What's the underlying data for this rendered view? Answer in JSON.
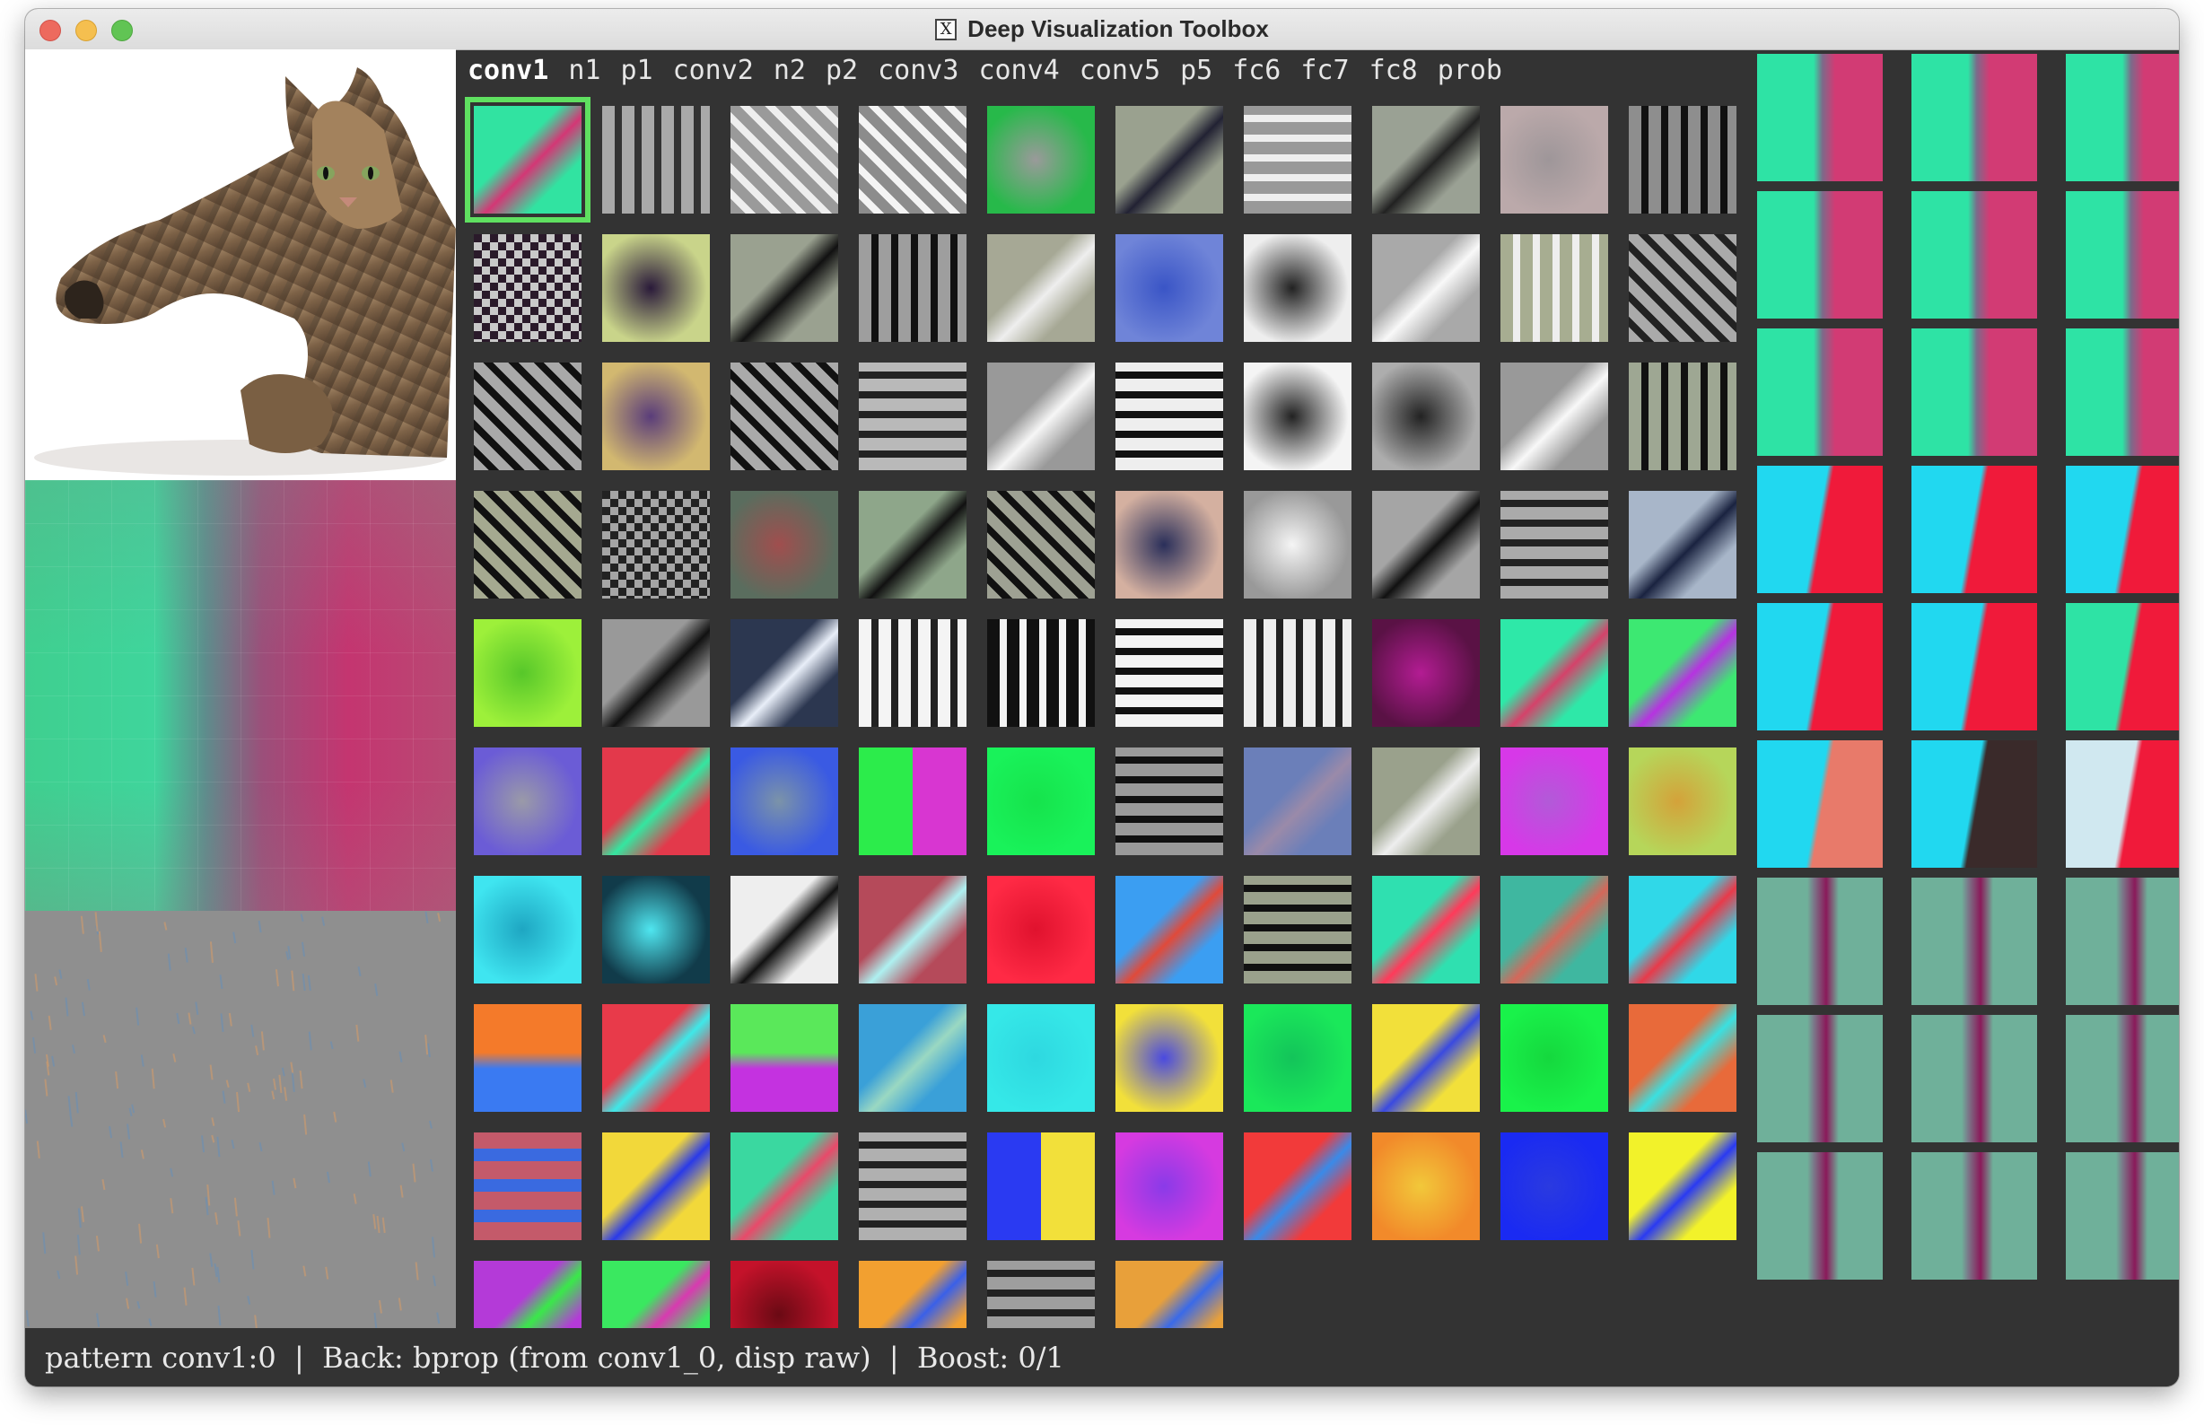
{
  "window": {
    "title": "Deep Visualization Toolbox"
  },
  "layers": [
    "conv1",
    "n1",
    "p1",
    "conv2",
    "n2",
    "p2",
    "conv3",
    "conv4",
    "conv5",
    "p5",
    "fc6",
    "fc7",
    "fc8",
    "prob"
  ],
  "active_layer": "conv1",
  "status": {
    "text": "pattern conv1:0  |  Back: bprop (from conv1_0, disp raw)  |  Boost: 0/1"
  },
  "panels": {
    "input_image": "cat-photo",
    "selected_unit_zoom": "unit-0-zoomed",
    "backprop_view": "bprop-gradient-view"
  },
  "filters": [
    [
      "#31e3a1",
      "#d33775",
      "diag"
    ],
    [
      "#a9a9a9",
      "#333",
      "vbars"
    ],
    [
      "#9a9a9a",
      "#eee",
      "diagbars"
    ],
    [
      "#8c8c8c",
      "#f4f4f4",
      "diagbars"
    ],
    [
      "#27b94a",
      "#9a9a9a",
      "blob"
    ],
    [
      "#9aa18f",
      "#223",
      "diag"
    ],
    [
      "#999",
      "#eee",
      "hbars"
    ],
    [
      "#9aa194",
      "#222",
      "diag"
    ],
    [
      "#bba9aa",
      "#9e9699",
      "blob"
    ],
    [
      "#8e8e8e",
      "#111",
      "vbars"
    ],
    [
      "#c9c9c9",
      "#2a1a2a",
      "checker"
    ],
    [
      "#c9d48a",
      "#2a1a3a",
      "blob"
    ],
    [
      "#9aa190",
      "#111",
      "diag"
    ],
    [
      "#9e9e9e",
      "#111",
      "vbars"
    ],
    [
      "#a6a895",
      "#eee",
      "diag"
    ],
    [
      "#6f84d8",
      "#3a55c6",
      "blob"
    ],
    [
      "#eeeeee",
      "#222",
      "blob"
    ],
    [
      "#a9a9a9",
      "#f8f8f8",
      "diag"
    ],
    [
      "#a7ad91",
      "#eee",
      "vbars"
    ],
    [
      "#aaaaaa",
      "#222",
      "diagbars"
    ],
    [
      "#a9a9a9",
      "#111",
      "diagbars"
    ],
    [
      "#d2b870",
      "#5a3d7a",
      "blob"
    ],
    [
      "#aaaaaa",
      "#111",
      "diagbars"
    ],
    [
      "#b9b9b9",
      "#222",
      "hbars"
    ],
    [
      "#999",
      "#f6f6f6",
      "diag"
    ],
    [
      "#eeeeee",
      "#111",
      "hbars"
    ],
    [
      "#f4f4f4",
      "#222",
      "blob"
    ],
    [
      "#adadad",
      "#222",
      "blob"
    ],
    [
      "#999",
      "#f8f8f8",
      "diag"
    ],
    [
      "#9ea793",
      "#111",
      "vbars"
    ],
    [
      "#a5a990",
      "#111",
      "diagbars"
    ],
    [
      "#a5a5a5",
      "#222",
      "checker"
    ],
    [
      "#5a6d5e",
      "#a04e4e",
      "blob"
    ],
    [
      "#8ea68a",
      "#111",
      "diag"
    ],
    [
      "#9ea193",
      "#111",
      "diagbars"
    ],
    [
      "#d4b0a0",
      "#2a2f5a",
      "blob"
    ],
    [
      "#999",
      "#f5f5f5",
      "blob"
    ],
    [
      "#a5a5a5",
      "#111",
      "diag"
    ],
    [
      "#aaa",
      "#222",
      "hbars"
    ],
    [
      "#a8b6c9",
      "#1a2340",
      "diag"
    ],
    [
      "#9df03a",
      "#57c72a",
      "blob"
    ],
    [
      "#999",
      "#111",
      "diag"
    ],
    [
      "#2c3750",
      "#e8eef8",
      "diag"
    ],
    [
      "#f4f4f4",
      "#222",
      "vbars"
    ],
    [
      "#111",
      "#f4f4f4",
      "vbars"
    ],
    [
      "#f4f4f4",
      "#111",
      "hbars"
    ],
    [
      "#eee",
      "#222",
      "vbars"
    ],
    [
      "#5a1245",
      "#b31c93",
      "blob"
    ],
    [
      "#2ee8a8",
      "#d4426a",
      "diag"
    ],
    [
      "#3de872",
      "#b633e0",
      "diag"
    ],
    [
      "#6b5cd6",
      "#9a9aa8",
      "blob"
    ],
    [
      "#e3394b",
      "#34e6a0",
      "diag"
    ],
    [
      "#3a5ae3",
      "#7b93a9",
      "blob"
    ],
    [
      "#2cec4b",
      "#d836d1",
      "vsplit"
    ],
    [
      "#19f25a",
      "#16e34c",
      "blob"
    ],
    [
      "#9a9a9a",
      "#111",
      "hbars"
    ],
    [
      "#6b7fb9",
      "#9a8aa9",
      "diag"
    ],
    [
      "#9aa18c",
      "#eee",
      "diag"
    ],
    [
      "#d738e8",
      "#b25ad8",
      "blob"
    ],
    [
      "#b6d65a",
      "#d4a23a",
      "blob"
    ],
    [
      "#3fe5f0",
      "#1ea6c2",
      "blob"
    ],
    [
      "#113b4a",
      "#4fe6f0",
      "blob"
    ],
    [
      "#eee",
      "#111",
      "diag"
    ],
    [
      "#b54a5a",
      "#aef0f0",
      "diag"
    ],
    [
      "#ff2a45",
      "#e0122e",
      "blob"
    ],
    [
      "#3b9ef2",
      "#e04a3a",
      "diag"
    ],
    [
      "#9aa18c",
      "#111",
      "hbars"
    ],
    [
      "#2fe0b0",
      "#ff3a5a",
      "diag"
    ],
    [
      "#3fb7a0",
      "#d4685a",
      "diag"
    ],
    [
      "#30d8e8",
      "#e83a4a",
      "diag"
    ],
    [
      "#f47a2a",
      "#3a7af2",
      "hsplit"
    ],
    [
      "#e83a4a",
      "#3fe8e8",
      "diag"
    ],
    [
      "#5ae85a",
      "#c432e0",
      "hsplit"
    ],
    [
      "#3aa0d8",
      "#9ad8c2",
      "diag"
    ],
    [
      "#35e8e8",
      "#2ed8e0",
      "blob"
    ],
    [
      "#f2e03a",
      "#4a4ae0",
      "blob"
    ],
    [
      "#1ae85a",
      "#13c45a",
      "blob"
    ],
    [
      "#f2e03a",
      "#3a4ae0",
      "diag"
    ],
    [
      "#19f24a",
      "#15d83e",
      "blob"
    ],
    [
      "#e86a3a",
      "#3ae0e0",
      "diag"
    ],
    [
      "#c45a6a",
      "#3a6ae0",
      "hbars2"
    ],
    [
      "#f2d83a",
      "#2a3ae8",
      "diag"
    ],
    [
      "#3ad8a0",
      "#e84a6a",
      "diag"
    ],
    [
      "#b0b0b0",
      "#222",
      "hbars"
    ],
    [
      "#2a3af2",
      "#f2e03a",
      "vsplit"
    ],
    [
      "#d63ae0",
      "#8a3ae8",
      "blob"
    ],
    [
      "#f23a3a",
      "#3a8ae8",
      "diag"
    ],
    [
      "#f28a2a",
      "#f2c83a",
      "blob"
    ],
    [
      "#1a2af2",
      "#2a3ae0",
      "blob"
    ],
    [
      "#f2f22a",
      "#2a3af2",
      "diag"
    ],
    [
      "#b43ad8",
      "#3ae84a",
      "diag"
    ],
    [
      "#3ae860",
      "#d83ab0",
      "diag"
    ],
    [
      "#c4122a",
      "#6a0a14",
      "blob"
    ],
    [
      "#f2a030",
      "#3a60e8",
      "diag"
    ],
    [
      "#9e9e9e",
      "#222",
      "hbars"
    ],
    [
      "#e8a03a",
      "#3a6ae8",
      "diag"
    ]
  ],
  "right_panel": [
    [
      "#2ee3a5",
      "#d23b74",
      "a"
    ],
    [
      "#2ee3a5",
      "#d23b74",
      "a"
    ],
    [
      "#2ee3a5",
      "#d23b74",
      "a"
    ],
    [
      "#2ee3a5",
      "#d23b74",
      "a"
    ],
    [
      "#2ee3a5",
      "#d23b74",
      "a"
    ],
    [
      "#2ee3a5",
      "#d23b74",
      "a"
    ],
    [
      "#2ee3a5",
      "#d23b74",
      "a"
    ],
    [
      "#2ee3a5",
      "#d23b74",
      "a"
    ],
    [
      "#2ee3a5",
      "#d23b74",
      "a"
    ],
    [
      "#21d8f0",
      "#f01a3a",
      "b"
    ],
    [
      "#21d8f0",
      "#f01a3a",
      "b"
    ],
    [
      "#21d8f0",
      "#f01a3a",
      "b"
    ],
    [
      "#21d8f0",
      "#f01a3a",
      "b"
    ],
    [
      "#21d8f0",
      "#f01a3a",
      "b"
    ],
    [
      "#2ee3a5",
      "#f01a3a",
      "b"
    ],
    [
      "#21d8f0",
      "#e87a6a",
      "b"
    ],
    [
      "#21d8f0",
      "#3a2a2a",
      "b"
    ],
    [
      "#d0e8f0",
      "#f01a3a",
      "b"
    ],
    [
      "#6fb09a",
      "#8a1a5a",
      "c"
    ],
    [
      "#6fb09a",
      "#8a1a5a",
      "c"
    ],
    [
      "#6fb09a",
      "#8a1a5a",
      "c"
    ],
    [
      "#6fb09a",
      "#8a1a5a",
      "c"
    ],
    [
      "#6fb09a",
      "#8a1a5a",
      "c"
    ],
    [
      "#6fb09a",
      "#8a1a5a",
      "c"
    ],
    [
      "#6fb09a",
      "#8a1a5a",
      "c"
    ],
    [
      "#6fb09a",
      "#8a1a5a",
      "c"
    ],
    [
      "#6fb09a",
      "#8a1a5a",
      "c"
    ]
  ]
}
